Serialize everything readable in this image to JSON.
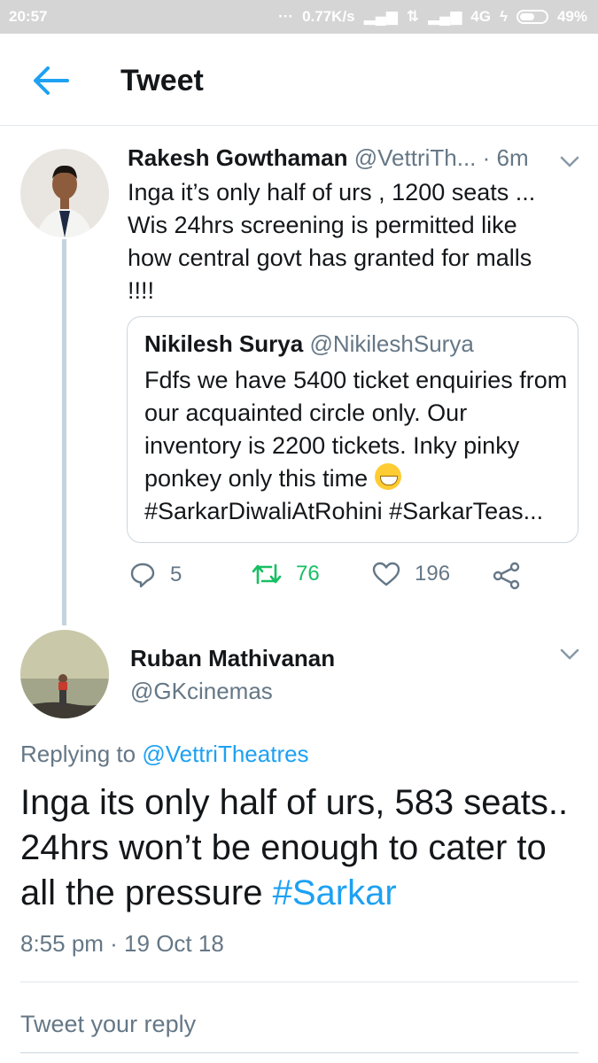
{
  "status_bar": {
    "time": "20:57",
    "network_speed": "0.77K/s",
    "network_type": "4G",
    "battery": "49%"
  },
  "header": {
    "title": "Tweet",
    "back_icon": "arrow-left-icon"
  },
  "tweet1": {
    "name": "Rakesh Gowthaman",
    "handle": "@VettriTh...",
    "time": "· 6m",
    "text": "Inga it’s only half of urs , 1200 seats ... Wis 24hrs screening is permitted like how central govt has granted for malls !!!!",
    "quote": {
      "name": "Nikilesh Surya",
      "handle": "@NikileshSurya",
      "text_before_emoji": "Fdfs we have 5400 ticket enquiries from our acquainted circle only. Our inventory is 2200 tickets. Inky pinky ponkey only this time ",
      "text_after_emoji": "#SarkarDiwaliAtRohini #SarkarTeas..."
    },
    "actions": {
      "replies": "5",
      "retweets": "76",
      "likes": "196"
    }
  },
  "tweet2": {
    "name": "Ruban Mathivanan",
    "handle": "@GKcinemas",
    "replying_prefix": "Replying to ",
    "replying_to": "@VettriTheatres",
    "text": "Inga its only half of urs, 583 seats.. 24hrs won’t be enough to cater to all the pressure ",
    "hashtag": "#Sarkar",
    "timestamp": "8:55 pm · 19 Oct 18"
  },
  "reply_placeholder": "Tweet your reply",
  "colors": {
    "accent": "#1da1f2",
    "retweet": "#17bf63",
    "muted": "#657786"
  }
}
